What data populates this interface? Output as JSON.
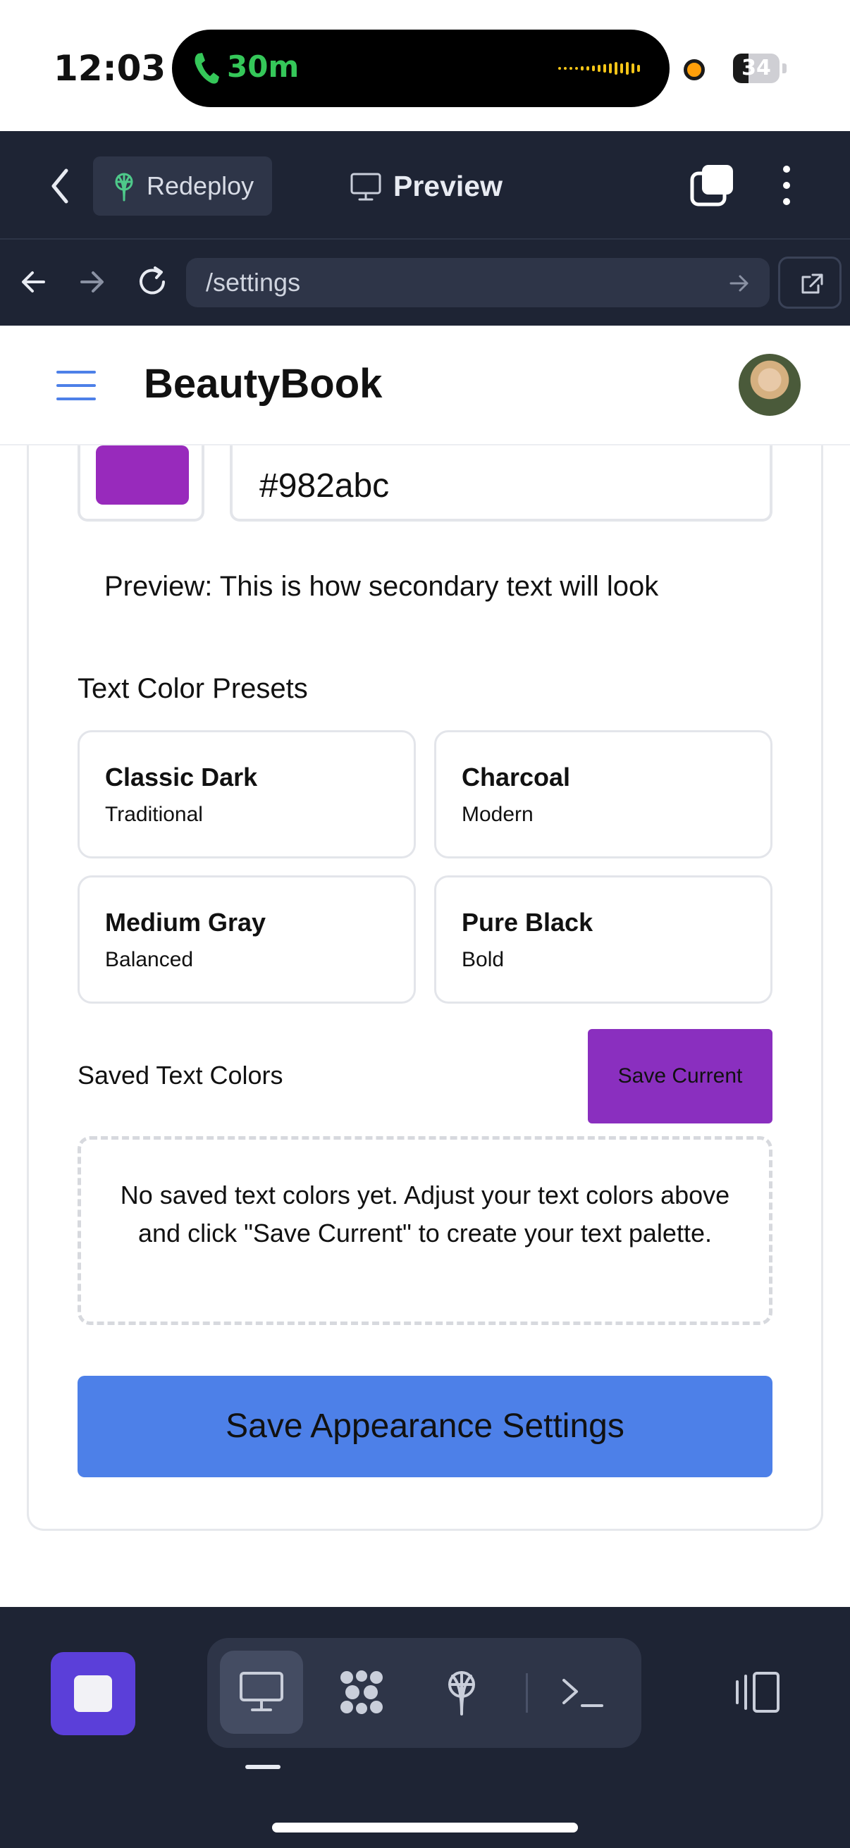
{
  "status_bar": {
    "time": "12:03",
    "call_duration": "30m",
    "battery": "34",
    "battery_level": 0.34,
    "icons": [
      "phone-icon",
      "waveform-icon",
      "recording-dot",
      "battery-icon"
    ]
  },
  "app_bar": {
    "back_icon": "chevron-left-icon",
    "redeploy_label": "Redeploy",
    "redeploy_icon": "antenna-icon",
    "preview_label": "Preview",
    "preview_icon": "monitor-icon",
    "tabs_icon": "tabs-icon",
    "menu_icon": "kebab-icon"
  },
  "url_bar": {
    "url": "/settings",
    "icons": [
      "arrow-left-icon",
      "arrow-right-icon",
      "reload-icon",
      "arrow-right-icon",
      "external-link-icon"
    ]
  },
  "site": {
    "title": "BeautyBook",
    "menu_icon": "hamburger-icon"
  },
  "color_picker": {
    "swatch_color": "#982abc",
    "hex_value": "#982abc"
  },
  "preview_text": "Preview: This is how secondary text will look",
  "presets": {
    "heading": "Text Color Presets",
    "items": [
      {
        "name": "Classic Dark",
        "desc": "Traditional"
      },
      {
        "name": "Charcoal",
        "desc": "Modern"
      },
      {
        "name": "Medium Gray",
        "desc": "Balanced"
      },
      {
        "name": "Pure Black",
        "desc": "Bold"
      }
    ]
  },
  "saved": {
    "heading": "Saved Text Colors",
    "save_current_label": "Save Current",
    "empty_message": "No saved text colors yet. Adjust your text colors above and click \"Save Current\" to create your text palette."
  },
  "save_appearance_label": "Save Appearance Settings",
  "colors": {
    "accent_purple": "#8a2fbf",
    "primary_blue": "#4d80e8",
    "dark_bg": "#1e2434",
    "stop_purple": "#5b3fd9"
  },
  "bottom_bar": {
    "icons": [
      "stop-icon",
      "monitor-icon",
      "apps-icon",
      "antenna-icon",
      "terminal-icon",
      "panel-icon"
    ]
  }
}
